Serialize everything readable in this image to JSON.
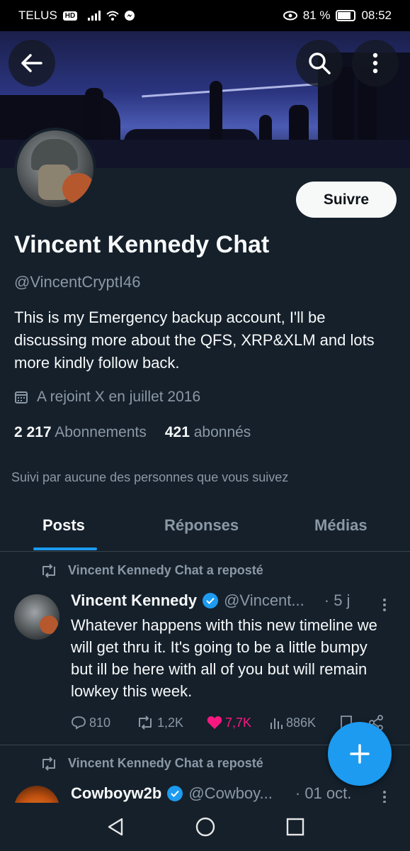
{
  "status_bar": {
    "carrier": "TELUS",
    "carrier_badge": "HD",
    "battery": "81 %",
    "battery_level": 0.81,
    "time": "08:52"
  },
  "profile": {
    "follow_label": "Suivre",
    "name": "Vincent Kennedy Chat",
    "handle": "@VincentCryptI46",
    "bio": "This is my Emergency backup account, I'll be discussing more about the QFS, XRP&XLM and lots more kindly follow back.",
    "joined": "A rejoint X en juillet 2016",
    "following_count": "2 217",
    "following_label": "Abonnements",
    "followers_count": "421",
    "followers_label": "abonnés",
    "followed_by": "Suivi par aucune des personnes que vous suivez"
  },
  "tabs": [
    "Posts",
    "Réponses",
    "Médias"
  ],
  "posts": [
    {
      "repost_label": "Vincent Kennedy Chat a reposté",
      "author": "Vincent Kennedy",
      "handle": "@Vincent...",
      "time": "· 5 j",
      "text": "Whatever happens with this new timeline we will get thru it. It's going to be a little bumpy but ill be here with all of you but will remain lowkey this week.",
      "replies": "810",
      "reposts": "1,2K",
      "likes": "7,7K",
      "views": "886K"
    },
    {
      "repost_label": "Vincent Kennedy Chat a reposté",
      "author": "Cowboyw2b",
      "handle": "@Cowboy...",
      "time": "· 01 oct."
    }
  ],
  "colors": {
    "background": "#15202b",
    "accent": "#1d9bf0",
    "like": "#f91880",
    "muted": "#8b98a5"
  }
}
